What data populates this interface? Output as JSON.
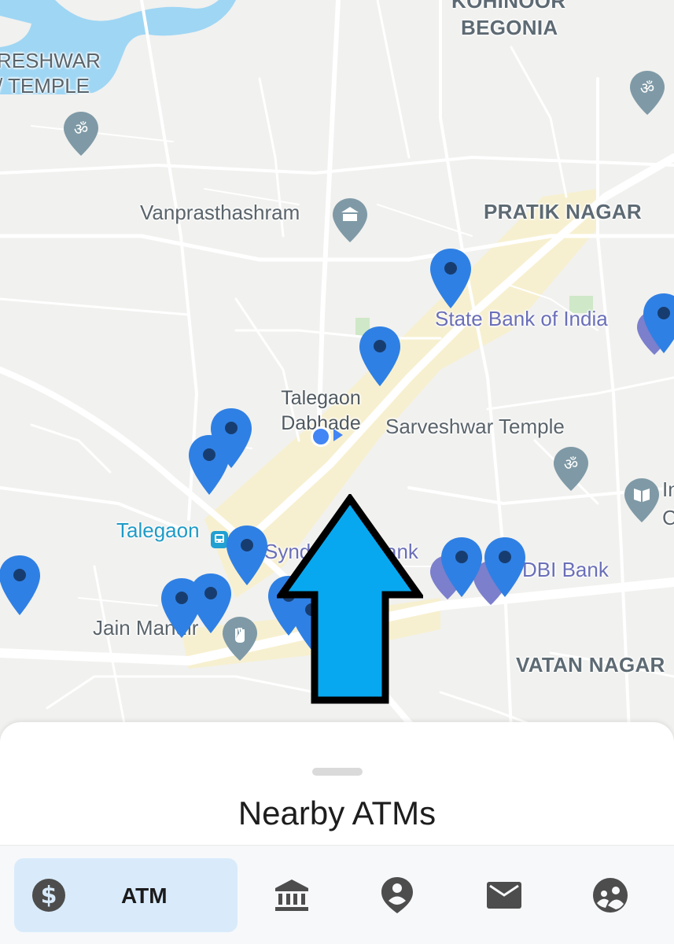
{
  "map": {
    "area_labels": [
      "KOHINOOR",
      "BEGONIA",
      "PRATIK NAGAR",
      "VATAN NAGAR",
      "RESHWAR",
      "/ TEMPLE"
    ],
    "poi_labels": [
      "Vanprasthashram",
      "Sarveshwar Temple",
      "Jain Mandir",
      "In",
      "C"
    ],
    "bank_labels": [
      "State Bank of India",
      "Synd",
      "ank",
      "DBI Bank"
    ],
    "transit_label": "Talegaon",
    "center_label_line1": "Talegaon",
    "center_label_line2": "Dabhade",
    "colors": {
      "water": "#9fd6f4",
      "land": "#f1f1ef",
      "road": "#ffffff",
      "highlight": "#f7efcc",
      "marker": "#2f80e4",
      "marker_dot": "#173d70",
      "arrow": "#08a8f0"
    }
  },
  "sheet": {
    "title": "Nearby ATMs"
  },
  "nav": {
    "atm_label": "ATM",
    "items": [
      "dollar-icon",
      "bank-icon",
      "person-pin-icon",
      "mail-icon",
      "group-icon"
    ]
  }
}
